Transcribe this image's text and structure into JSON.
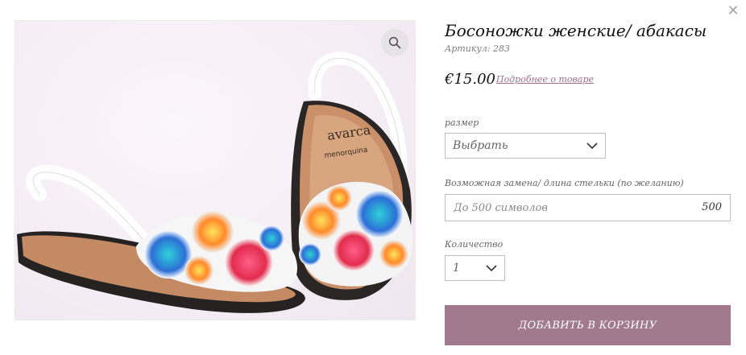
{
  "modal": {
    "close_icon": "close-icon",
    "close_symbol": "✕"
  },
  "product": {
    "title": "Босоножки женские/ абакасы",
    "sku": "Артикул: 283",
    "price": "€15.00",
    "details_link": "Подробнее о товаре",
    "image": {
      "brand_text": "avarca",
      "brand_sub": "menorquina",
      "zoom_icon": "magnifier-icon"
    }
  },
  "options": {
    "size": {
      "label": "размер",
      "selected": "Выбрать"
    },
    "note": {
      "label": "Возможная замена/ длина стельки (по желанию)",
      "placeholder": "До 500 символов",
      "counter": "500"
    },
    "quantity": {
      "label": "Количество",
      "selected": "1"
    }
  },
  "actions": {
    "add_to_cart": "ДОБАВИТЬ В КОРЗИНУ"
  },
  "colors": {
    "accent": "#a27a8d",
    "link": "#9d6f8a"
  }
}
